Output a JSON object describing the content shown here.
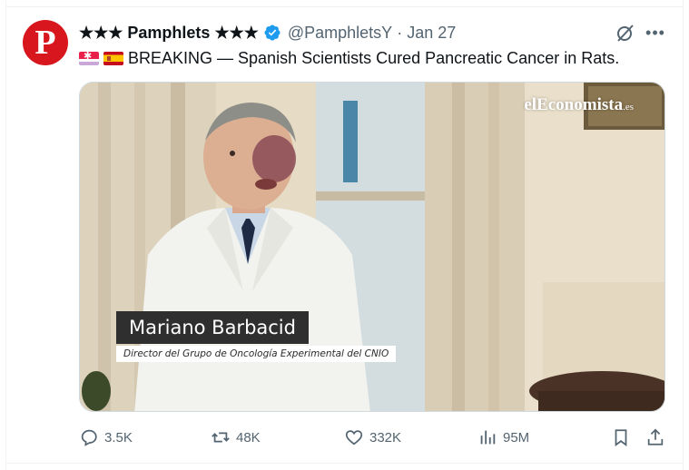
{
  "post": {
    "author_name": "★★★ Pamphlets ★★★",
    "handle": "@PamphletsY",
    "separator": "·",
    "date": "Jan 27",
    "avatar_letter": "P",
    "text": "BREAKING — Spanish Scientists Cured Pancreatic Cancer in Rats.",
    "flags": [
      "madrid-flag-icon",
      "spain-flag-icon"
    ]
  },
  "media": {
    "watermark": "elEconomista",
    "watermark_suffix": ".es",
    "lower_third_name": "Mariano Barbacid",
    "lower_third_role": "Director del Grupo de Oncología Experimental del CNIO"
  },
  "actions": {
    "replies": "3.5K",
    "reposts": "48K",
    "likes": "332K",
    "views": "95M"
  },
  "colors": {
    "avatar": "#d7161d",
    "verified": "#1d9bf0",
    "secondary_text": "#536471",
    "primary_text": "#0f1419"
  }
}
